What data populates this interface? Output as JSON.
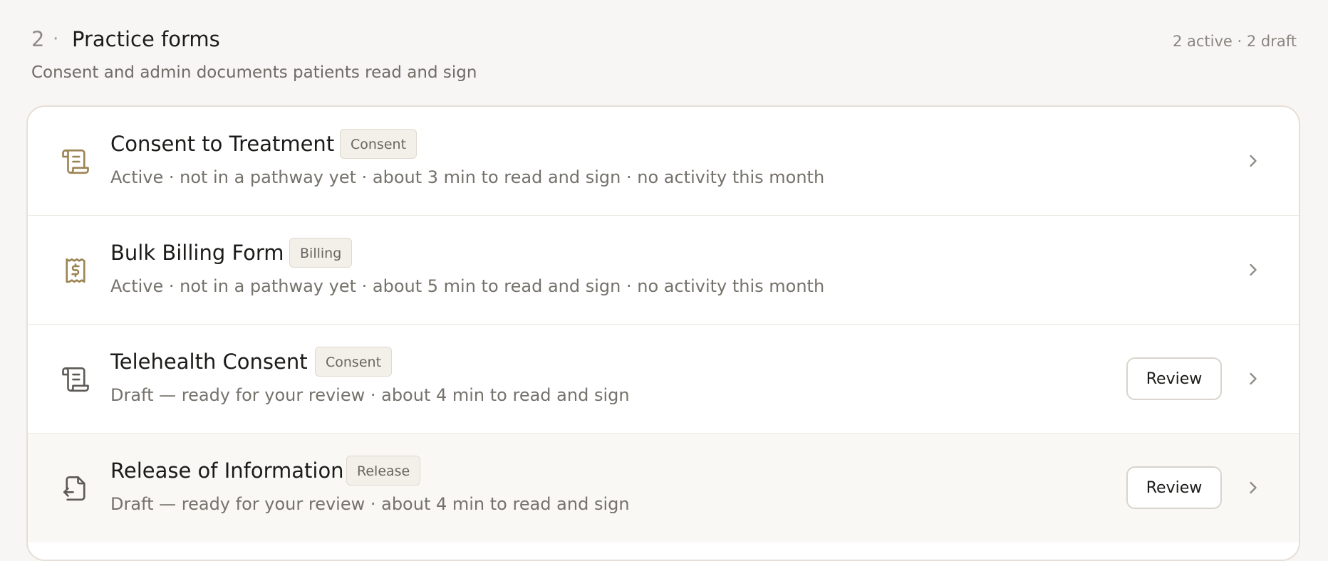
{
  "section": {
    "number": "2",
    "separator": "·",
    "title": "Practice forms",
    "summary": "2 active · 2 draft",
    "subtitle": "Consent and admin documents patients read and sign"
  },
  "forms": [
    {
      "title": "Consent to Treatment",
      "badge": "Consent",
      "meta": "Active · not in a pathway yet · about 3 min to read and sign · no activity this month",
      "icon": "scroll-icon",
      "status": "active"
    },
    {
      "title": "Bulk Billing Form",
      "badge": "Billing",
      "meta": "Active · not in a pathway yet · about 5 min to read and sign · no activity this month",
      "icon": "receipt-dollar-icon",
      "status": "active"
    },
    {
      "title": "Telehealth Consent",
      "badge": "Consent",
      "meta": "Draft — ready for your review · about 4 min to read and sign",
      "icon": "scroll-icon",
      "status": "draft",
      "action_label": "Review"
    },
    {
      "title": "Release of Information",
      "badge": "Release",
      "meta": "Draft — ready for your review · about 4 min to read and sign",
      "icon": "file-export-icon",
      "status": "draft",
      "action_label": "Review"
    }
  ],
  "colors": {
    "active_icon": "#9b8453",
    "draft_icon": "#5e5a55",
    "chevron": "#8f8b85",
    "badge_bg": "#f3efe9",
    "page_bg": "#f7f6f4"
  }
}
